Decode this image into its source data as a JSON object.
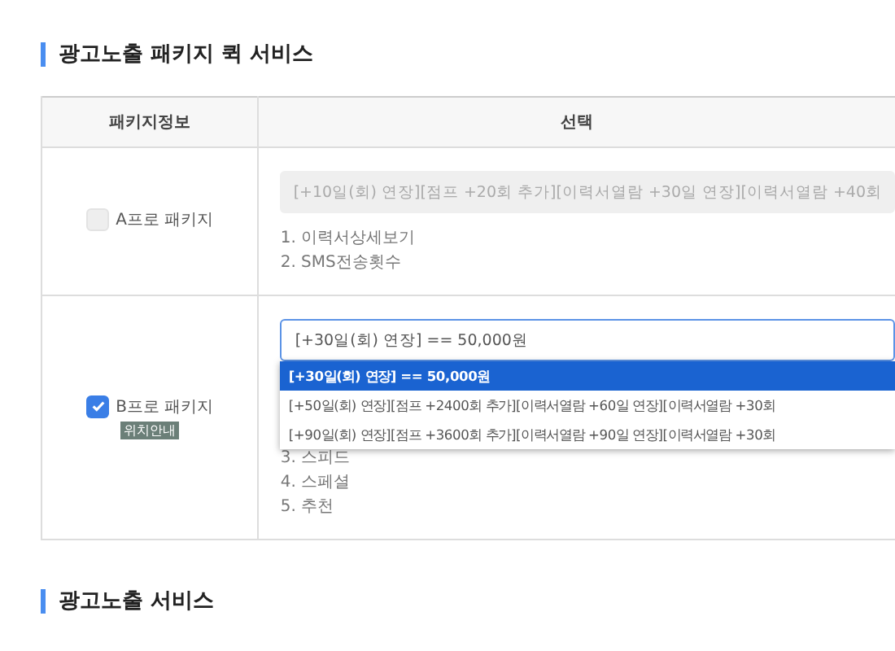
{
  "sections": [
    {
      "title": "광고노출 패키지 퀵 서비스"
    },
    {
      "title": "광고노출 서비스"
    }
  ],
  "table": {
    "columns": [
      "패키지정보",
      "선택"
    ],
    "rows": [
      {
        "package": "A프로 패키지",
        "checked": false,
        "badge": null,
        "select": {
          "value": "[+10일(회) 연장][점프 +20회 추가][이력서열람 +30일 연장][이력서열람 +40회",
          "disabled": true,
          "expanded": false
        },
        "features": [
          "1. 이력서상세보기",
          "2. SMS전송횟수"
        ]
      },
      {
        "package": "B프로 패키지",
        "checked": true,
        "badge": "위치안내",
        "select": {
          "value": "[+30일(회) 연장] == 50,000원",
          "disabled": false,
          "expanded": true,
          "options": [
            {
              "label": "[+30일(회) 연장] == 50,000원",
              "selected": true
            },
            {
              "label": "[+50일(회) 연장][점프 +2400회 추가][이력서열람 +60일 연장][이력서열람 +30회",
              "selected": false
            },
            {
              "label": "[+90일(회) 연장][점프 +3600회 추가][이력서열람 +90일 연장][이력서열람 +30회",
              "selected": false
            }
          ]
        },
        "features": [
          "3. 스피드",
          "4. 스페셜",
          "5. 추천"
        ]
      }
    ]
  }
}
